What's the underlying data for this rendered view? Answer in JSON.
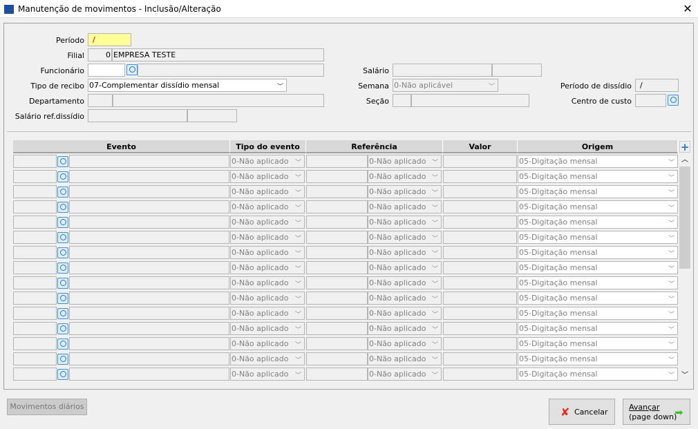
{
  "window": {
    "title": "Manutenção de movimentos - Inclusão/Alteração",
    "close_icon": "close-icon"
  },
  "form": {
    "periodo": {
      "label": "Período",
      "value": "/"
    },
    "filial": {
      "label": "Filial",
      "code": "0",
      "name": "EMPRESA TESTE"
    },
    "funcionario": {
      "label": "Funcionário",
      "code": "",
      "name": ""
    },
    "tipo_recibo": {
      "label": "Tipo de recibo",
      "value": "07-Complementar dissídio mensal"
    },
    "departamento": {
      "label": "Departamento"
    },
    "salario_ref": {
      "label": "Salário ref.dissídio"
    },
    "salario": {
      "label": "Salário"
    },
    "semana": {
      "label": "Semana",
      "value": "0-Não aplicável"
    },
    "secao": {
      "label": "Seção"
    },
    "periodo_dissidio": {
      "label": "Período de dissídio",
      "value": "/"
    },
    "centro_custo": {
      "label": "Centro de custo"
    }
  },
  "grid": {
    "columns": [
      "Evento",
      "Tipo do evento",
      "Referência",
      "Valor",
      "Origem"
    ],
    "rows": [
      {
        "tipo": "0-Não aplicado",
        "referencia": "0-Não aplicado",
        "origem": "05-Digitação mensal"
      },
      {
        "tipo": "0-Não aplicado",
        "referencia": "0-Não aplicado",
        "origem": "05-Digitação mensal"
      },
      {
        "tipo": "0-Não aplicado",
        "referencia": "0-Não aplicado",
        "origem": "05-Digitação mensal"
      },
      {
        "tipo": "0-Não aplicado",
        "referencia": "0-Não aplicado",
        "origem": "05-Digitação mensal"
      },
      {
        "tipo": "0-Não aplicado",
        "referencia": "0-Não aplicado",
        "origem": "05-Digitação mensal"
      },
      {
        "tipo": "0-Não aplicado",
        "referencia": "0-Não aplicado",
        "origem": "05-Digitação mensal"
      },
      {
        "tipo": "0-Não aplicado",
        "referencia": "0-Não aplicado",
        "origem": "05-Digitação mensal"
      },
      {
        "tipo": "0-Não aplicado",
        "referencia": "0-Não aplicado",
        "origem": "05-Digitação mensal"
      },
      {
        "tipo": "0-Não aplicado",
        "referencia": "0-Não aplicado",
        "origem": "05-Digitação mensal"
      },
      {
        "tipo": "0-Não aplicado",
        "referencia": "0-Não aplicado",
        "origem": "05-Digitação mensal"
      },
      {
        "tipo": "0-Não aplicado",
        "referencia": "0-Não aplicado",
        "origem": "05-Digitação mensal"
      },
      {
        "tipo": "0-Não aplicado",
        "referencia": "0-Não aplicado",
        "origem": "05-Digitação mensal"
      },
      {
        "tipo": "0-Não aplicado",
        "referencia": "0-Não aplicado",
        "origem": "05-Digitação mensal"
      },
      {
        "tipo": "0-Não aplicado",
        "referencia": "0-Não aplicado",
        "origem": "05-Digitação mensal"
      },
      {
        "tipo": "0-Não aplicado",
        "referencia": "0-Não aplicado",
        "origem": "05-Digitação mensal"
      }
    ],
    "add_icon": "plus-icon"
  },
  "buttons": {
    "movimentos": "Movimentos diários",
    "cancelar": "Cancelar",
    "avancar_1": "Avançar",
    "avancar_2": "(page down)"
  },
  "colors": {
    "required_field": "#ffff99",
    "add": "#1e78d7",
    "cancel_icon": "#e03020",
    "next_icon": "#40c030"
  }
}
